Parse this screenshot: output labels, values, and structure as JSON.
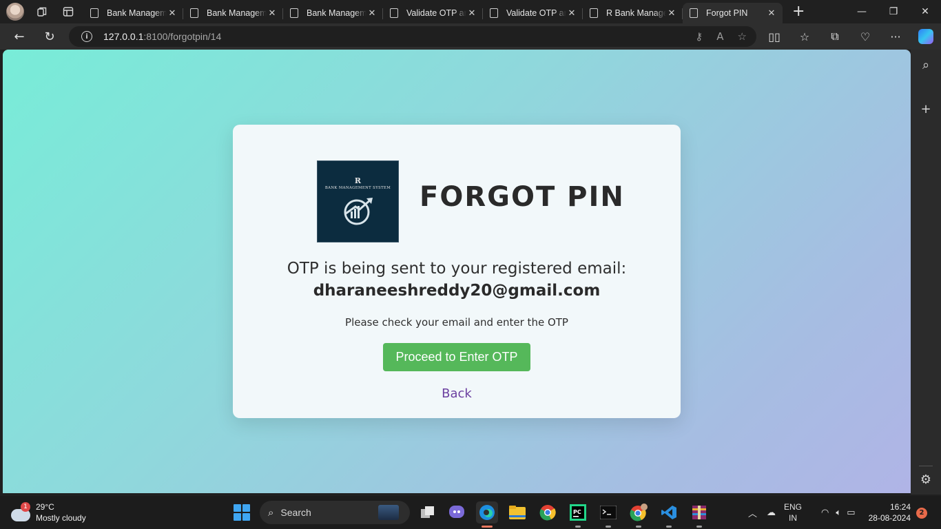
{
  "browser": {
    "tabs": [
      {
        "title": "Bank Management System",
        "active": false
      },
      {
        "title": "Bank Management System",
        "active": false
      },
      {
        "title": "Bank Management System",
        "active": false
      },
      {
        "title": "Validate OTP and Reset PIN",
        "active": false
      },
      {
        "title": "Validate OTP and Reset PIN",
        "active": false
      },
      {
        "title": "R Bank Management System",
        "active": false
      },
      {
        "title": "Forgot PIN",
        "active": true
      }
    ],
    "url_host": "127.0.0.1",
    "url_rest": ":8100/forgotpin/14"
  },
  "page": {
    "logo_letter": "R",
    "logo_text": "BANK MANAGEMENT SYSTEM",
    "heading": "FORGOT PIN",
    "message": "OTP is being sent to your registered email:",
    "email": "dharaneeshreddy20@gmail.com",
    "hint": "Please check your email and enter the OTP",
    "proceed_label": "Proceed to Enter OTP",
    "back_label": "Back",
    "colors": {
      "button": "#55b85a",
      "link": "#6b3fa0",
      "logo_bg": "#0c2c3f"
    }
  },
  "taskbar": {
    "weather_badge": "1",
    "temperature": "29°C",
    "condition": "Mostly cloudy",
    "search_label": "Search",
    "lang_top": "ENG",
    "lang_bottom": "IN",
    "time": "16:24",
    "date": "28-08-2024",
    "notification_count": "2"
  }
}
